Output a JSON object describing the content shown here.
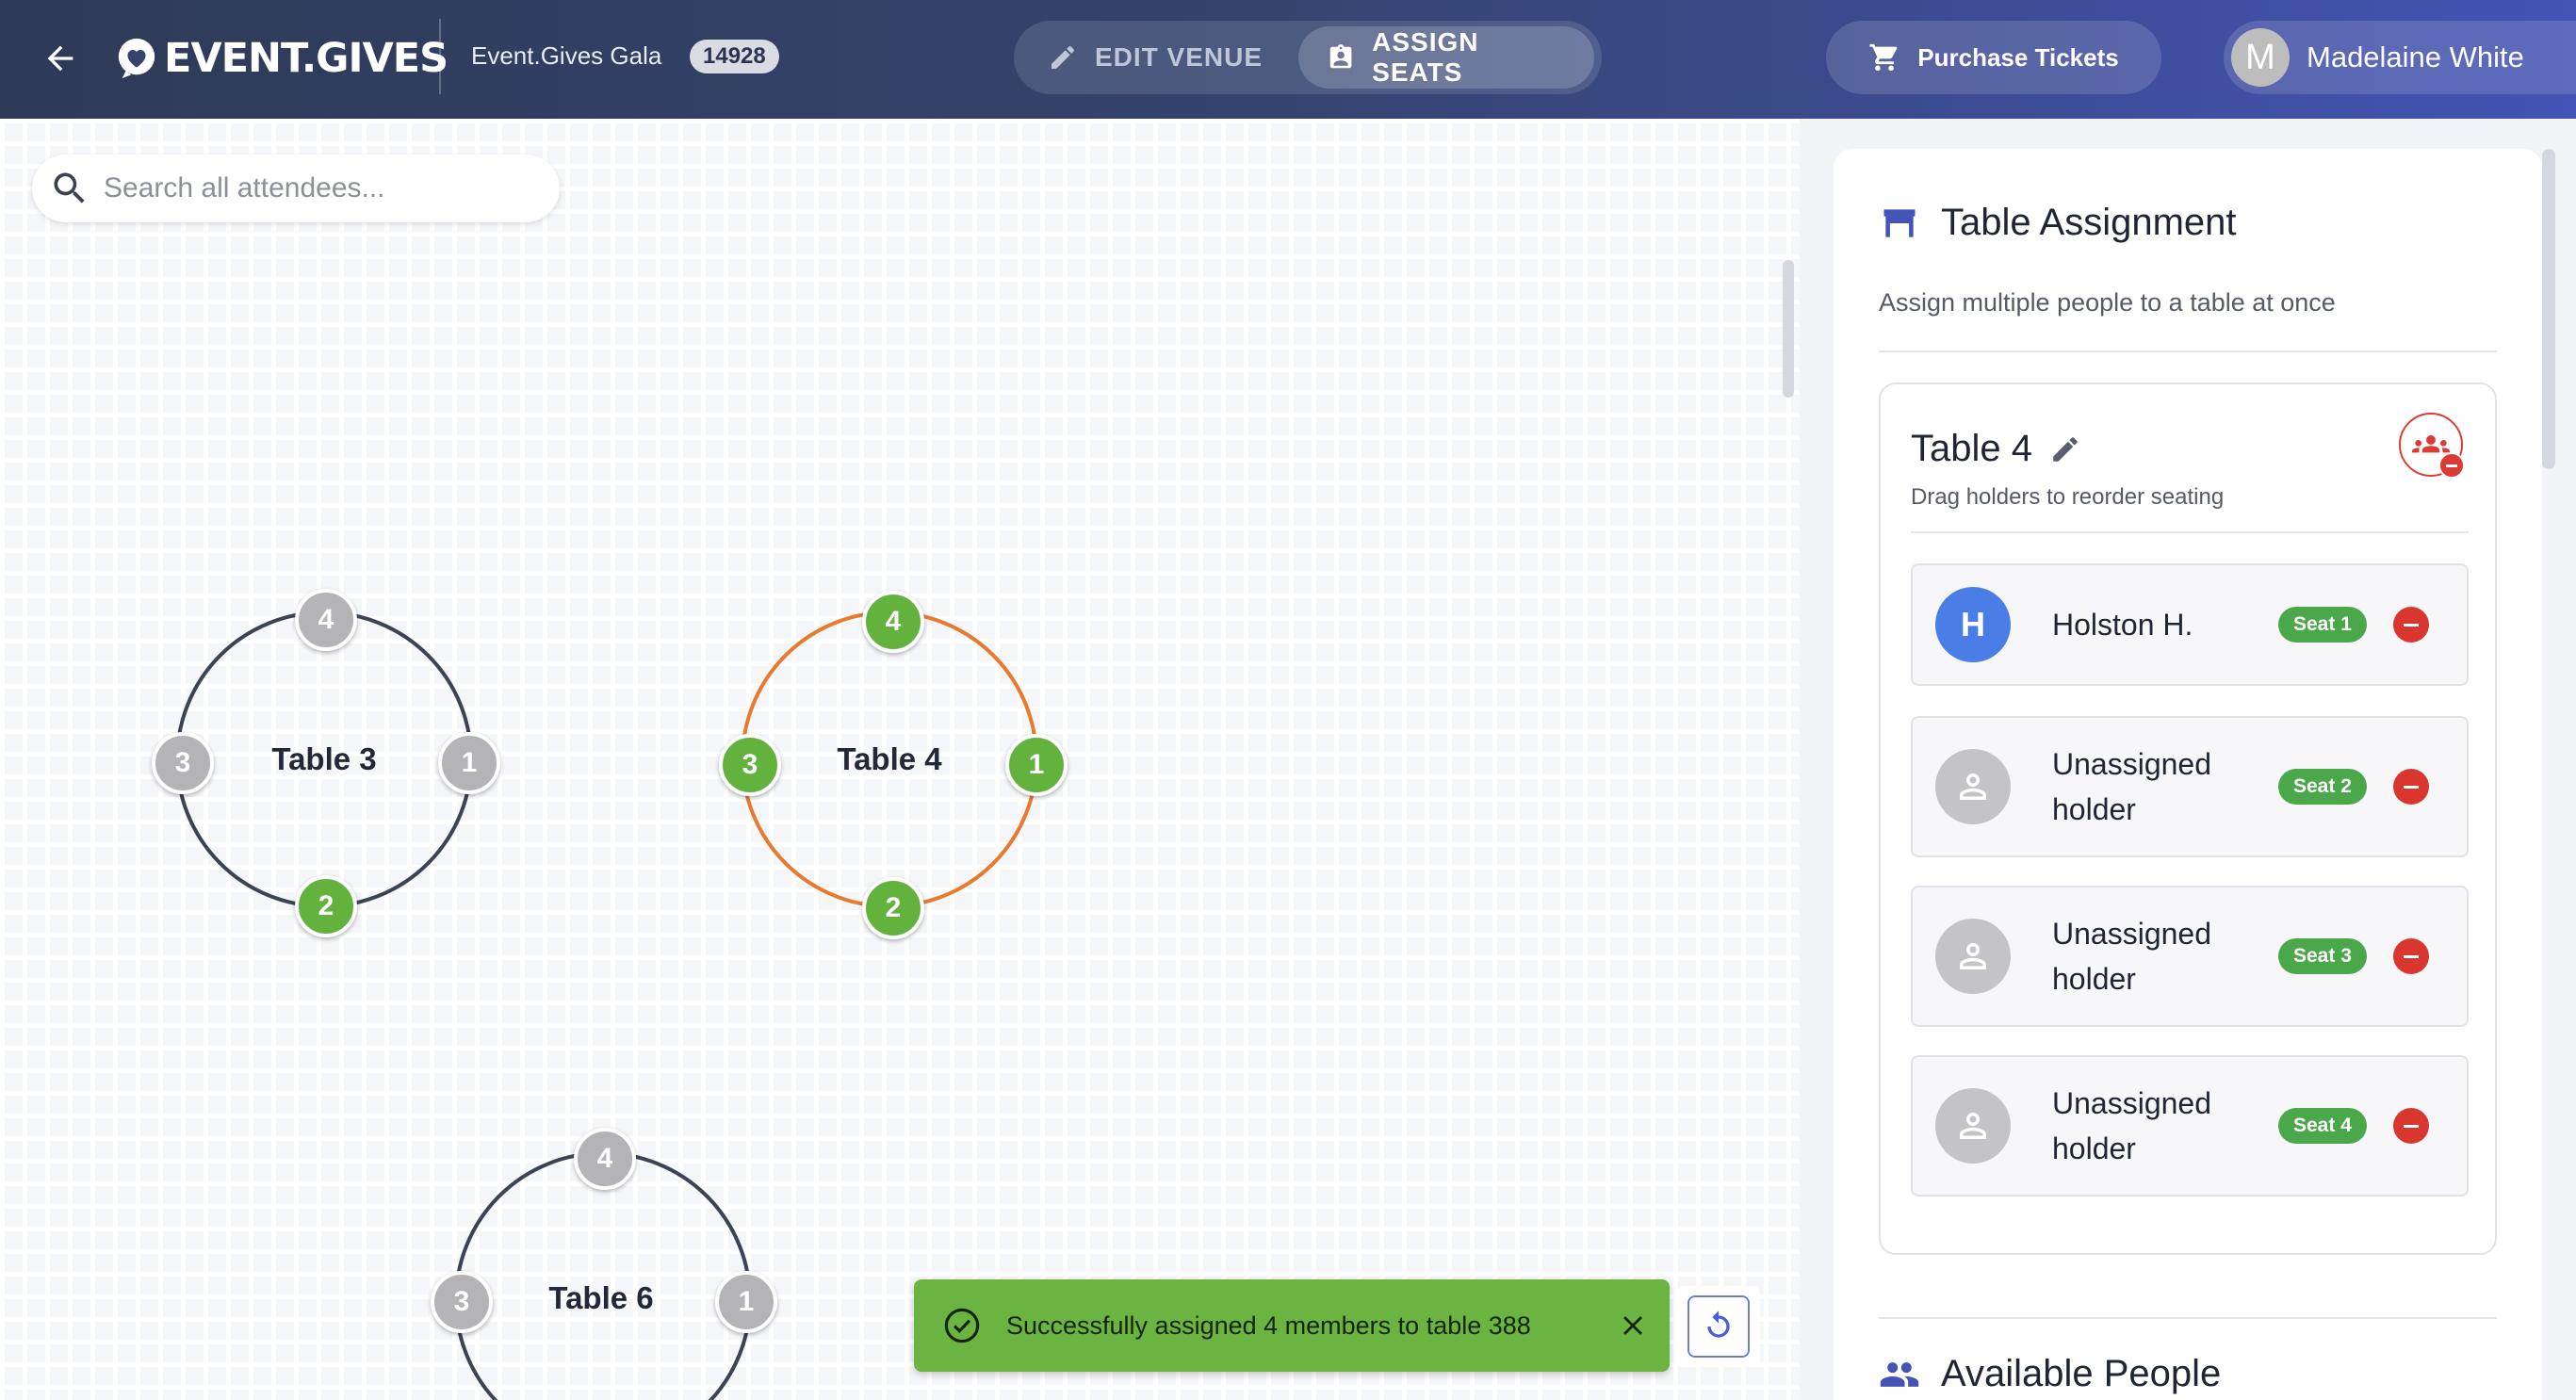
{
  "header": {
    "logo_text": "EVENT.GIVES",
    "event_name": "Event.Gives Gala",
    "event_id": "14928",
    "modes": {
      "edit": "EDIT VENUE",
      "assign": "ASSIGN SEATS"
    },
    "active_mode": "assign",
    "purchase_label": "Purchase Tickets",
    "user": {
      "initial": "M",
      "name": "Madelaine White"
    }
  },
  "canvas": {
    "search_placeholder": "Search all attendees...",
    "tables": [
      {
        "label": "Table 3",
        "selected": false,
        "seats": [
          {
            "number": "1",
            "filled": false
          },
          {
            "number": "2",
            "filled": true
          },
          {
            "number": "3",
            "filled": false
          },
          {
            "number": "4",
            "filled": false
          }
        ]
      },
      {
        "label": "Table 4",
        "selected": true,
        "seats": [
          {
            "number": "1",
            "filled": true
          },
          {
            "number": "2",
            "filled": true
          },
          {
            "number": "3",
            "filled": true
          },
          {
            "number": "4",
            "filled": true
          }
        ]
      },
      {
        "label": "Table 6",
        "selected": false,
        "seats": [
          {
            "number": "1",
            "filled": false
          },
          {
            "number": "3",
            "filled": false
          },
          {
            "number": "4",
            "filled": false
          }
        ]
      }
    ],
    "toast": "Successfully assigned 4 members to table 388"
  },
  "panel": {
    "title": "Table Assignment",
    "subtitle": "Assign multiple people to a table at once",
    "card": {
      "title": "Table 4",
      "subtitle": "Drag holders to reorder seating",
      "holders": [
        {
          "initial": "H",
          "name": "Holston H.",
          "seat": "Seat 1",
          "assigned": true
        },
        {
          "initial": "",
          "name": "Unassigned holder",
          "seat": "Seat 2",
          "assigned": false
        },
        {
          "initial": "",
          "name": "Unassigned holder",
          "seat": "Seat 3",
          "assigned": false
        },
        {
          "initial": "",
          "name": "Unassigned holder",
          "seat": "Seat 4",
          "assigned": false
        }
      ]
    },
    "available_title": "Available People"
  },
  "colors": {
    "accent": "#4453b4",
    "seat_filled": "#62b23d",
    "seat_empty": "#b4b4b6",
    "selected_table": "#e87a2e",
    "danger": "#d9362f"
  }
}
